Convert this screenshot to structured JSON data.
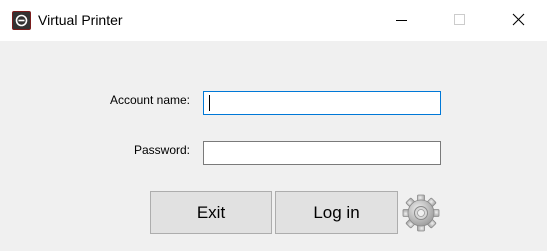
{
  "window": {
    "title": "Virtual Printer",
    "app_icon": "virtual-printer-app-icon",
    "controls": {
      "minimize_icon": "minimize-icon",
      "maximize_icon": "maximize-icon",
      "close_icon": "close-icon"
    }
  },
  "form": {
    "account_label": "Account name:",
    "account_value": "",
    "password_label": "Password:",
    "password_value": ""
  },
  "buttons": {
    "exit_label": "Exit",
    "login_label": "Log in",
    "settings_icon": "gear-icon"
  },
  "colors": {
    "focus_border": "#0078d7",
    "window_bg": "#f0f0f0",
    "button_bg": "#e1e1e1"
  }
}
